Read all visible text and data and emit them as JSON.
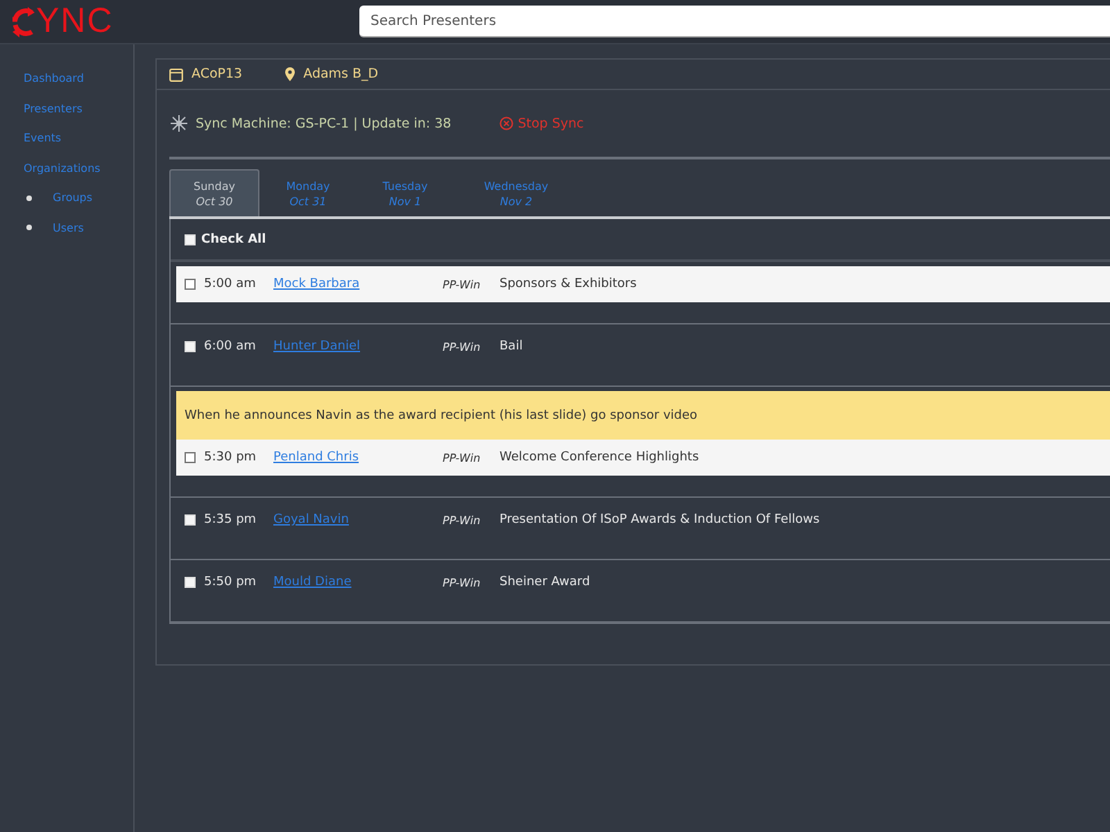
{
  "logo": {
    "text": "YNC"
  },
  "search": {
    "placeholder": "Search Presenters"
  },
  "sidebar": {
    "items": [
      {
        "label": "Dashboard"
      },
      {
        "label": "Presenters"
      },
      {
        "label": "Events"
      },
      {
        "label": "Organizations",
        "children": [
          {
            "label": "Groups"
          },
          {
            "label": "Users"
          }
        ]
      }
    ]
  },
  "header": {
    "event": "ACoP13",
    "room": "Adams B_D"
  },
  "sync": {
    "status": "Sync Machine: GS-PC-1 | Update in: 38",
    "stop_label": "Stop Sync"
  },
  "tabs": [
    {
      "day": "Sunday",
      "date": "Oct 30",
      "selected": true
    },
    {
      "day": "Monday",
      "date": "Oct 31",
      "selected": false
    },
    {
      "day": "Tuesday",
      "date": "Nov 1",
      "selected": false
    },
    {
      "day": "Wednesday",
      "date": "Nov 2",
      "selected": false
    }
  ],
  "check_all": {
    "label": "Check All",
    "checked": false
  },
  "rows": [
    {
      "time": "5:00 am",
      "presenter": "Mock Barbara",
      "type": "PP-Win",
      "title": "Sponsors & Exhibitors",
      "checked": false,
      "highlighted": true
    },
    {
      "time": "6:00 am",
      "presenter": "Hunter Daniel",
      "type": "PP-Win",
      "title": "Bail",
      "checked": false,
      "highlighted": false
    },
    {
      "note": "When he announces Navin as the award recipient (his last slide) go sponsor video",
      "time": "5:30 pm",
      "presenter": "Penland Chris",
      "type": "PP-Win",
      "title": "Welcome Conference Highlights",
      "checked": false,
      "highlighted": true
    },
    {
      "time": "5:35 pm",
      "presenter": "Goyal Navin",
      "type": "PP-Win",
      "title": "Presentation Of ISoP Awards & Induction Of Fellows",
      "checked": false,
      "highlighted": false
    },
    {
      "time": "5:50 pm",
      "presenter": "Mould Diane",
      "type": "PP-Win",
      "title": "Sheiner Award",
      "checked": false,
      "highlighted": false
    }
  ]
}
